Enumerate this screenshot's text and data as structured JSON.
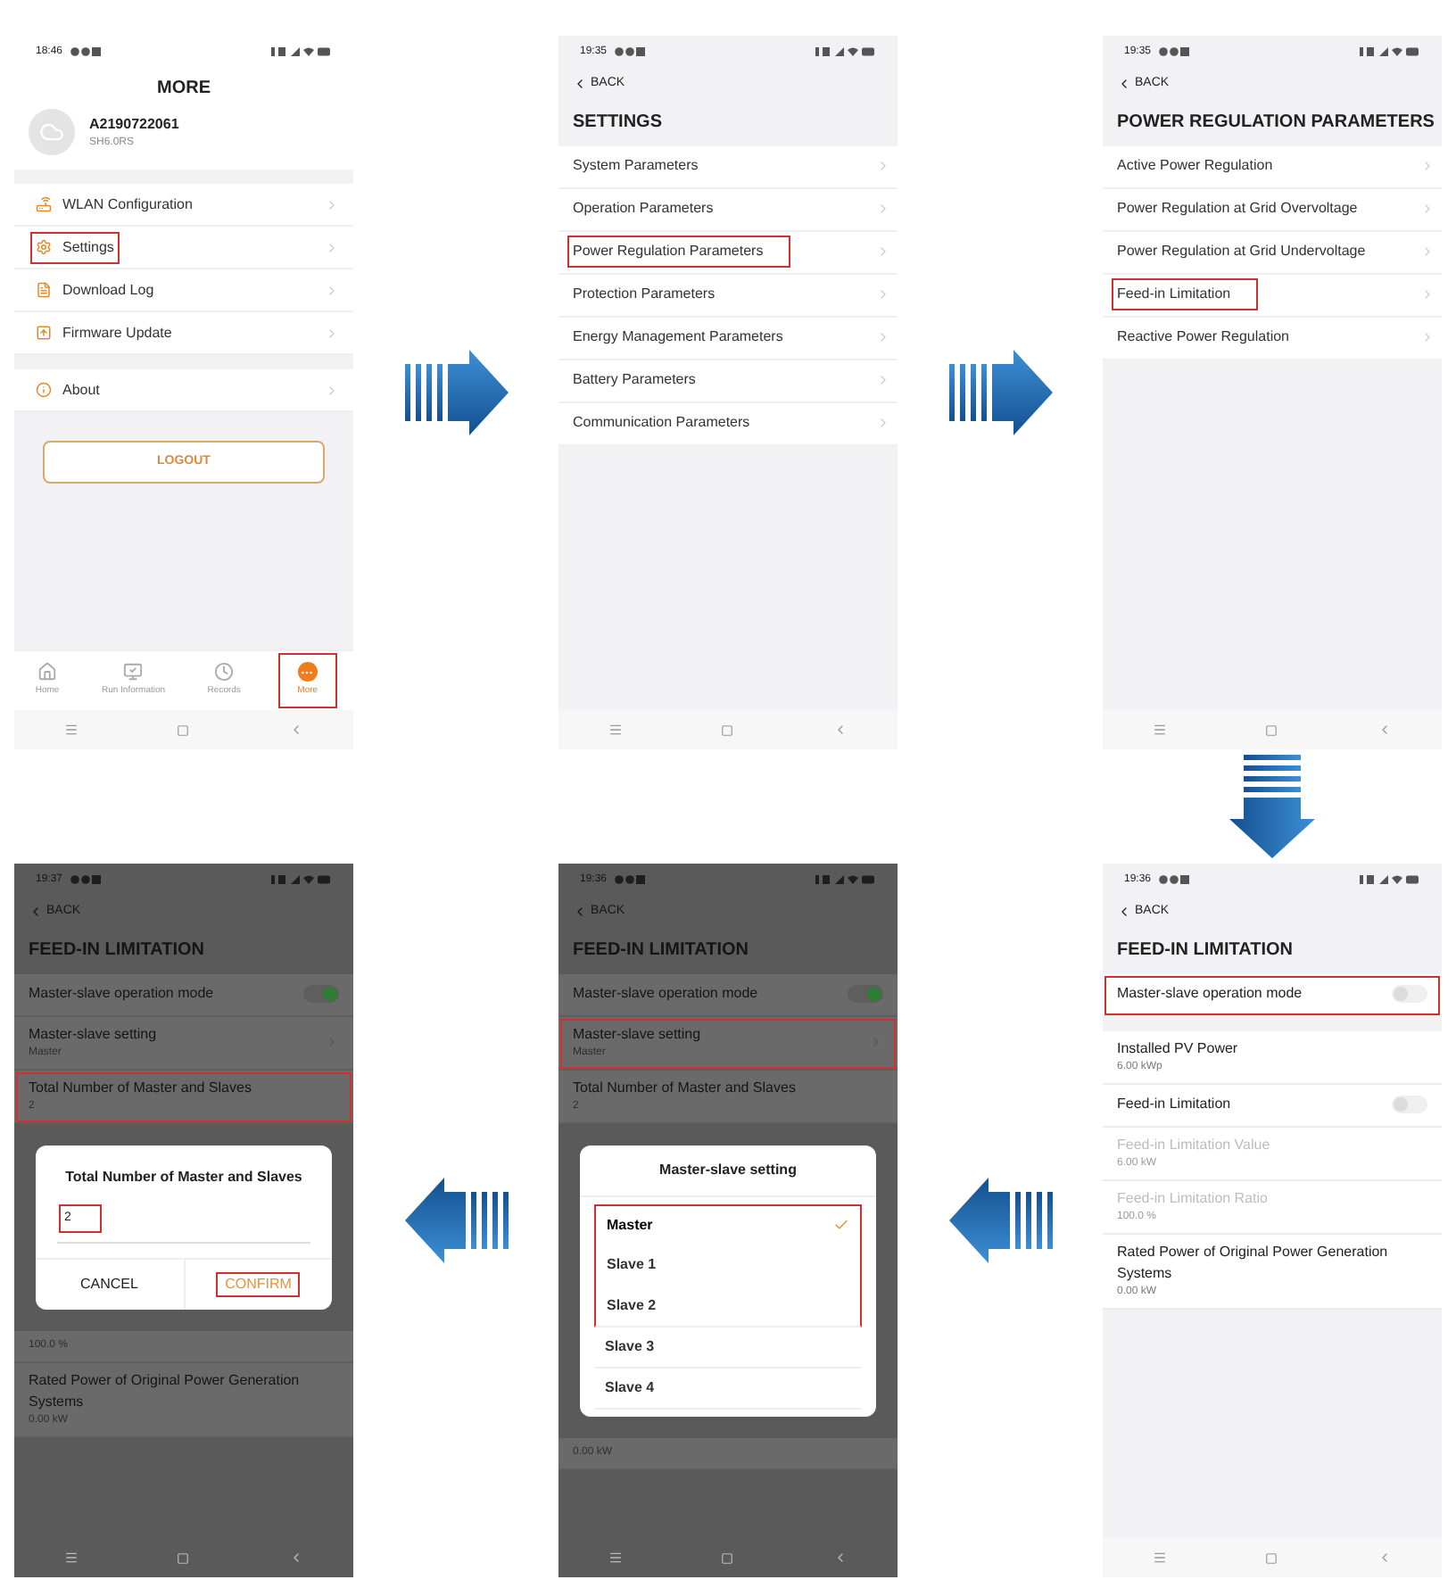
{
  "top_row": [
    {
      "kind": "screen",
      "screen": {
        "kind": "more",
        "time": "18:46",
        "title": "MORE",
        "device": {
          "name": "A2190722061",
          "model": "SH6.0RS"
        },
        "menu_groups": [
          [
            {
              "label": "WLAN Configuration",
              "highlighted": false
            },
            {
              "label": "Settings",
              "highlighted": true
            },
            {
              "label": "Download Log",
              "highlighted": false
            },
            {
              "label": "Firmware Update",
              "highlighted": false
            }
          ],
          [
            {
              "label": "About",
              "highlighted": false
            }
          ]
        ],
        "logout": "LOGOUT",
        "tabs": [
          {
            "label": "Home",
            "selected": false,
            "highlighted": false
          },
          {
            "label": "Run Information",
            "selected": false,
            "highlighted": false
          },
          {
            "label": "Records",
            "selected": false,
            "highlighted": false
          },
          {
            "label": "More",
            "selected": true,
            "highlighted": true
          }
        ]
      }
    },
    {
      "kind": "arrow_right"
    },
    {
      "kind": "screen",
      "screen": {
        "kind": "list",
        "time": "19:35",
        "back": "BACK",
        "title": "SETTINGS",
        "items": [
          {
            "label": "System Parameters",
            "highlighted": false
          },
          {
            "label": "Operation Parameters",
            "highlighted": false
          },
          {
            "label": "Power Regulation Parameters",
            "highlighted": true
          },
          {
            "label": "Protection Parameters",
            "highlighted": false
          },
          {
            "label": "Energy Management Parameters",
            "highlighted": false
          },
          {
            "label": "Battery Parameters",
            "highlighted": false
          },
          {
            "label": "Communication Parameters",
            "highlighted": false
          }
        ]
      }
    },
    {
      "kind": "arrow_right"
    },
    {
      "kind": "screen",
      "screen": {
        "kind": "list",
        "time": "19:35",
        "back": "BACK",
        "title": "POWER REGULATION PARAMETERS",
        "items": [
          {
            "label": "Active Power Regulation",
            "highlighted": false
          },
          {
            "label": "Power Regulation at Grid Overvoltage",
            "highlighted": false
          },
          {
            "label": "Power Regulation at Grid Undervoltage",
            "highlighted": false
          },
          {
            "label": "Feed-in Limitation",
            "highlighted": true
          },
          {
            "label": "Reactive Power Regulation",
            "highlighted": false
          }
        ]
      }
    }
  ],
  "down_arrow": {
    "kind": "arrow_down"
  },
  "bottom_row": [
    {
      "kind": "screen",
      "screen": {
        "kind": "feed_in",
        "time": "19:37",
        "back": "BACK",
        "title": "FEED-IN LIMITATION",
        "dimmed": true,
        "sections": [
          {
            "kind": "rows",
            "rows": [
              {
                "kind": "toggle",
                "label": "Master-slave operation mode",
                "on": true,
                "highlighted": false
              },
              {
                "kind": "select",
                "label": "Master-slave setting",
                "value": "Master",
                "highlighted": false,
                "disabled": false
              },
              {
                "kind": "value",
                "label": "Total Number of Master and Slaves",
                "value": "2",
                "highlighted": true,
                "disabled": false
              }
            ]
          },
          {
            "kind": "dialog",
            "dialog": {
              "kind": "input",
              "title": "Total Number of Master and Slaves",
              "value": "2",
              "value_highlighted": true,
              "buttons": [
                {
                  "label": "CANCEL",
                  "primary": false,
                  "highlighted": false
                },
                {
                  "label": "CONFIRM",
                  "primary": true,
                  "highlighted": true
                }
              ]
            }
          },
          {
            "kind": "rows",
            "rows": [
              {
                "kind": "value",
                "value": "100.0 %",
                "highlighted": false,
                "disabled": false
              },
              {
                "kind": "value",
                "label": "Rated Power of Original Power Generation Systems",
                "value": "0.00 kW",
                "highlighted": false,
                "disabled": false
              }
            ]
          }
        ]
      }
    },
    {
      "kind": "arrow_left"
    },
    {
      "kind": "screen",
      "screen": {
        "kind": "feed_in",
        "time": "19:36",
        "back": "BACK",
        "title": "FEED-IN LIMITATION",
        "dimmed": true,
        "sections": [
          {
            "kind": "rows",
            "rows": [
              {
                "kind": "toggle",
                "label": "Master-slave operation mode",
                "on": true,
                "highlighted": false
              },
              {
                "kind": "select",
                "label": "Master-slave setting",
                "value": "Master",
                "highlighted": true,
                "disabled": false
              },
              {
                "kind": "value",
                "label": "Total Number of Master and Slaves",
                "value": "2",
                "highlighted": false,
                "disabled": false
              }
            ]
          },
          {
            "kind": "dialog",
            "dialog": {
              "kind": "picker",
              "title": "Master-slave setting",
              "options": [
                {
                  "label": "Master",
                  "selected": true,
                  "highlighted": true
                },
                {
                  "label": "Slave 1",
                  "selected": false,
                  "highlighted": true
                },
                {
                  "label": "Slave 2",
                  "selected": false,
                  "highlighted": true
                },
                {
                  "label": "Slave 3",
                  "selected": false,
                  "highlighted": false
                },
                {
                  "label": "Slave 4",
                  "selected": false,
                  "highlighted": false
                }
              ]
            }
          },
          {
            "kind": "rows",
            "rows": [
              {
                "kind": "value",
                "value": "0.00 kW",
                "highlighted": false,
                "disabled": false
              }
            ]
          }
        ]
      }
    },
    {
      "kind": "arrow_left"
    },
    {
      "kind": "screen",
      "screen": {
        "kind": "feed_in",
        "time": "19:36",
        "back": "BACK",
        "title": "FEED-IN LIMITATION",
        "dimmed": false,
        "sections": [
          {
            "kind": "rows",
            "rows": [
              {
                "kind": "toggle",
                "label": "Master-slave operation mode",
                "on": false,
                "highlighted": true
              }
            ]
          },
          {
            "kind": "rows",
            "rows": [
              {
                "kind": "value",
                "label": "Installed PV Power",
                "value": "6.00 kWp",
                "highlighted": false,
                "disabled": false
              },
              {
                "kind": "toggle",
                "label": "Feed-in Limitation",
                "on": false,
                "highlighted": false
              },
              {
                "kind": "value",
                "label": "Feed-in Limitation Value",
                "value": "6.00 kW",
                "highlighted": false,
                "disabled": true
              },
              {
                "kind": "value",
                "label": "Feed-in Limitation Ratio",
                "value": "100.0 %",
                "highlighted": false,
                "disabled": true
              },
              {
                "kind": "value",
                "label": "Rated Power of Original Power Generation Systems",
                "value": "0.00 kW",
                "highlighted": false,
                "disabled": false
              }
            ]
          }
        ]
      }
    }
  ]
}
